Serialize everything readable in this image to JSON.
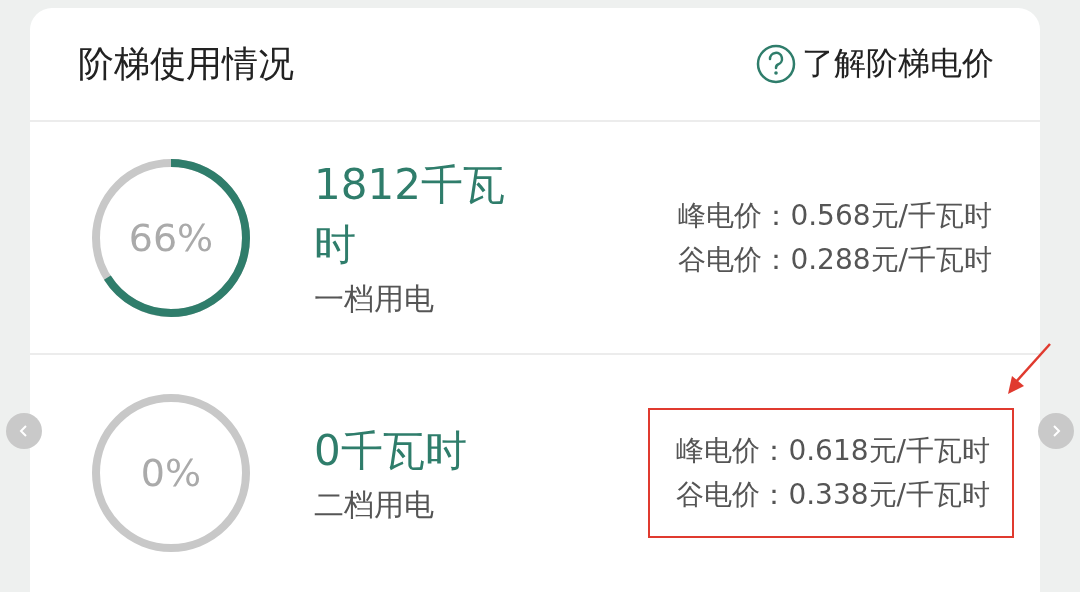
{
  "header": {
    "title": "阶梯使用情况",
    "help_link": "了解阶梯电价"
  },
  "tiers": [
    {
      "percent": "66%",
      "level": 0.66,
      "amount": "1812千瓦时",
      "label": "一档用电",
      "prices": [
        "峰电价：0.568元/千瓦时",
        "谷电价：0.288元/千瓦时"
      ],
      "highlighted": false
    },
    {
      "percent": "0%",
      "level": 0,
      "amount": "0千瓦时",
      "label": "二档用电",
      "prices": [
        "峰电价：0.618元/千瓦时",
        "谷电价：0.338元/千瓦时"
      ],
      "highlighted": true
    }
  ]
}
